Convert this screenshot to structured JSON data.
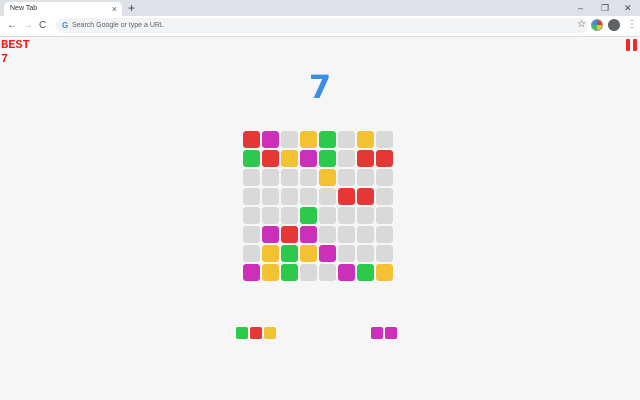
{
  "browser": {
    "tab_title": "New Tab",
    "tab_close": "×",
    "new_tab": "+",
    "window_controls": [
      "–",
      "❐",
      "✕"
    ],
    "nav": [
      "←",
      "→",
      "C"
    ],
    "omnibox_icon": "G",
    "omnibox_placeholder": "Search Google or type a URL",
    "star_icon": "☆",
    "menu_icon": "⋮"
  },
  "game": {
    "best_label": "BEST",
    "best_value": "7",
    "score": "7",
    "colors": {
      "R": "#e63636",
      "M": "#cc2fb8",
      "Y": "#f2c232",
      "G": "#2bc94c",
      "E": "#d9d9d9"
    },
    "board": [
      "RMEYGEYE",
      "GRYMGERR",
      "EEEEYEEE",
      "EEEEERRE",
      "EEEGEEEE",
      "EMRMEEEE",
      "EYGYMEEE",
      "MYGEEMGY"
    ],
    "pieces": [
      [
        "GRY"
      ],
      [
        "MM"
      ]
    ]
  }
}
